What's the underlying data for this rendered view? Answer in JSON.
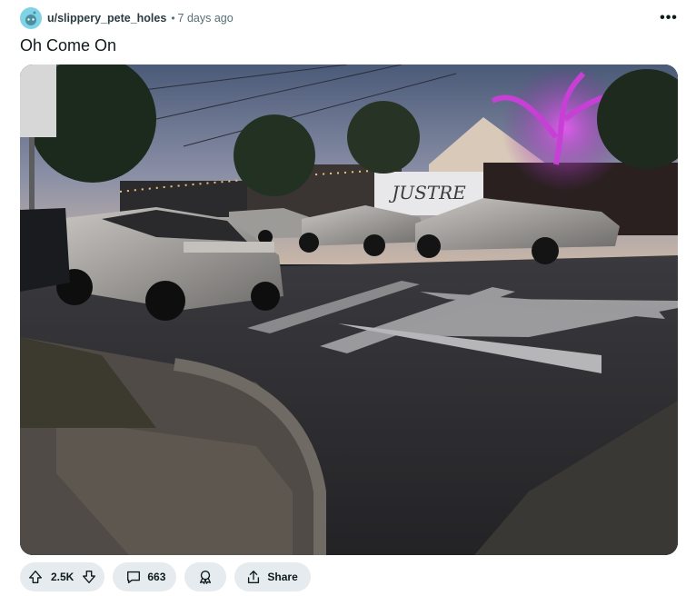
{
  "post": {
    "author": "u/slippery_pete_holes",
    "separator": "•",
    "time_ago": "7 days ago",
    "title": "Oh Come On"
  },
  "media": {
    "sign_text": "JUSTRE",
    "description_alt": "Cybertrucks parked along a street at dusk"
  },
  "actions": {
    "vote_count": "2.5K",
    "comment_count": "663",
    "share_label": "Share"
  },
  "icons": {
    "avatar": "snoo-avatar-icon",
    "more": "more-options-icon",
    "upvote": "upvote-icon",
    "downvote": "downvote-icon",
    "comment": "comment-icon",
    "award": "award-icon",
    "share": "share-icon"
  },
  "colors": {
    "avatar_bg": "#7fd3e4",
    "pill_bg": "#e5ebee",
    "tree_glow": "#c83fd6"
  }
}
